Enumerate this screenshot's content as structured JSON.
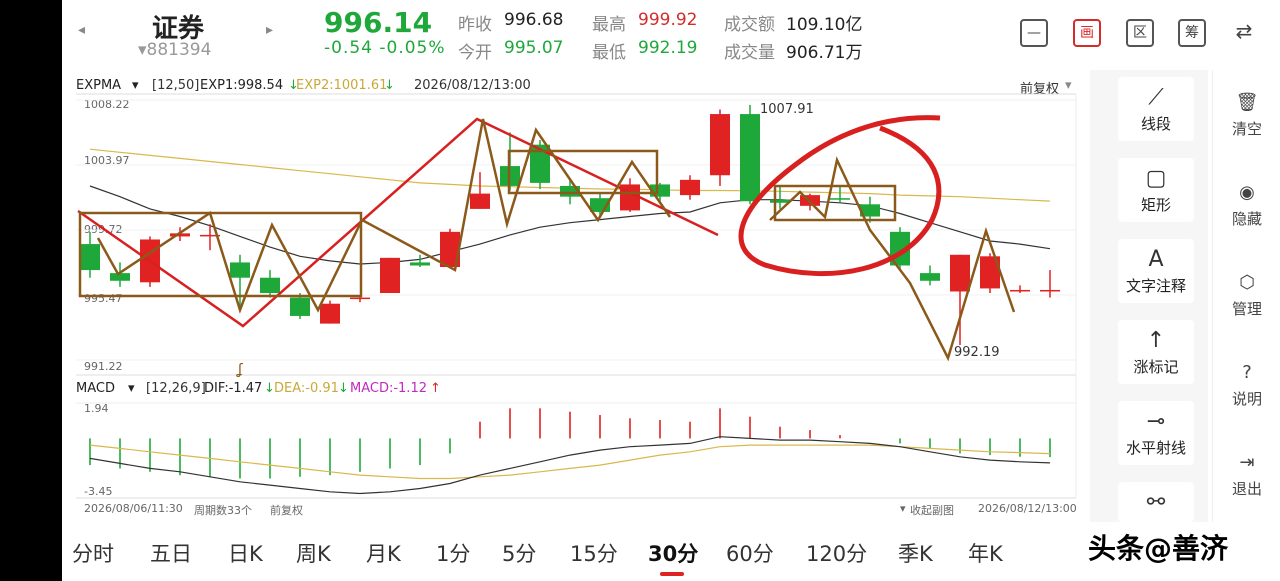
{
  "header": {
    "left_arrow": "◂",
    "right_arrow": "▸",
    "stock_name": "证券",
    "stock_code": "▾881394",
    "price": "996.14",
    "change": "-0.54 -0.05%",
    "quotes": [
      {
        "label": "昨收",
        "value": "996.68"
      },
      {
        "label": "今开",
        "value": "995.07"
      },
      {
        "label": "最高",
        "value": "999.92"
      },
      {
        "label": "最低",
        "value": "992.19"
      },
      {
        "label": "成交额",
        "value": "109.10亿"
      },
      {
        "label": "成交量",
        "value": "906.71万"
      }
    ],
    "tool_buttons": [
      {
        "name": "minus",
        "label": "—"
      },
      {
        "name": "draw",
        "label": "画"
      },
      {
        "name": "zone",
        "label": "区"
      },
      {
        "name": "chip",
        "label": "筹"
      },
      {
        "name": "device",
        "label": "⇄"
      }
    ]
  },
  "chart_data": [
    {
      "type": "candlestick",
      "indicator": "EXPMA",
      "params": "[12,50]",
      "exp1_label": "EXP1:998.54",
      "exp1_arrow": "↓",
      "exp2_label": "EXP2:1001.61",
      "exp2_arrow": "↓",
      "timestamp": "2026/08/12/13:00",
      "adjust": "前复权",
      "y_labels": [
        "1008.22",
        "1003.97",
        "999.72",
        "995.47",
        "991.22"
      ],
      "ylim": [
        991.22,
        1008.22
      ],
      "high_annotation": "1007.91",
      "low_annotation": "992.19",
      "candles": [
        {
          "o": 998.8,
          "h": 999.6,
          "c": 997.1,
          "l": 996.6
        },
        {
          "o": 996.9,
          "h": 997.6,
          "c": 996.4,
          "l": 996.0
        },
        {
          "o": 996.3,
          "h": 999.3,
          "c": 999.1,
          "l": 996.0
        },
        {
          "o": 999.3,
          "h": 999.9,
          "c": 999.5,
          "l": 999.0
        },
        {
          "o": 999.4,
          "h": 1000.1,
          "c": 999.4,
          "l": 998.4
        },
        {
          "o": 997.6,
          "h": 998.1,
          "c": 996.6,
          "l": 994.6
        },
        {
          "o": 996.6,
          "h": 997.1,
          "c": 995.6,
          "l": 995.3
        },
        {
          "o": 995.3,
          "h": 995.6,
          "c": 994.1,
          "l": 993.9
        },
        {
          "o": 993.6,
          "h": 995.1,
          "c": 994.9,
          "l": 993.6
        },
        {
          "o": 995.3,
          "h": 995.4,
          "c": 995.3,
          "l": 995.0
        },
        {
          "o": 995.6,
          "h": 997.9,
          "c": 997.9,
          "l": 995.6
        },
        {
          "o": 997.6,
          "h": 998.1,
          "c": 997.4,
          "l": 997.3
        },
        {
          "o": 997.3,
          "h": 999.8,
          "c": 999.6,
          "l": 997.3
        },
        {
          "o": 1001.1,
          "h": 1003.5,
          "c": 1002.1,
          "l": 1001.1
        },
        {
          "o": 1003.9,
          "h": 1006.1,
          "c": 1002.6,
          "l": 1002.3
        },
        {
          "o": 1005.3,
          "h": 1005.6,
          "c": 1002.8,
          "l": 1002.4
        },
        {
          "o": 1002.6,
          "h": 1003.1,
          "c": 1001.9,
          "l": 1001.4
        },
        {
          "o": 1001.8,
          "h": 1002.1,
          "c": 1000.9,
          "l": 1000.6
        },
        {
          "o": 1001.0,
          "h": 1003.1,
          "c": 1002.7,
          "l": 1000.9
        },
        {
          "o": 1002.7,
          "h": 1002.8,
          "c": 1001.9,
          "l": 1001.6
        },
        {
          "o": 1002.0,
          "h": 1003.3,
          "c": 1003.0,
          "l": 1001.7
        },
        {
          "o": 1003.3,
          "h": 1007.6,
          "c": 1007.3,
          "l": 1002.6
        },
        {
          "o": 1007.3,
          "h": 1007.9,
          "c": 1001.6,
          "l": 1001.4
        },
        {
          "o": 1001.7,
          "h": 1002.6,
          "c": 1001.5,
          "l": 1001.1
        },
        {
          "o": 1001.3,
          "h": 1002.1,
          "c": 1002.0,
          "l": 1001.0
        },
        {
          "o": 1001.8,
          "h": 1002.6,
          "c": 1001.7,
          "l": 1001.5
        },
        {
          "o": 1001.4,
          "h": 1001.9,
          "c": 1000.6,
          "l": 1000.2
        },
        {
          "o": 999.6,
          "h": 999.9,
          "c": 997.4,
          "l": 997.2
        },
        {
          "o": 996.9,
          "h": 997.4,
          "c": 996.4,
          "l": 996.1
        },
        {
          "o": 995.7,
          "h": 998.1,
          "c": 998.1,
          "l": 992.2
        },
        {
          "o": 995.9,
          "h": 998.2,
          "c": 998.0,
          "l": 995.6
        },
        {
          "o": 995.7,
          "h": 996.1,
          "c": 995.8,
          "l": 995.6
        },
        {
          "o": 995.7,
          "h": 997.1,
          "c": 995.8,
          "l": 995.3
        }
      ],
      "exp1": [
        1002.6,
        1001.9,
        1001.1,
        1000.6,
        1000.0,
        999.3,
        998.6,
        998.0,
        997.7,
        997.5,
        997.6,
        997.8,
        998.3,
        998.8,
        999.4,
        999.9,
        1000.2,
        1000.4,
        1000.6,
        1000.8,
        1000.9,
        1001.5,
        1001.7,
        1001.7,
        1001.6,
        1001.5,
        1001.3,
        1000.8,
        1000.2,
        999.6,
        999.0,
        998.8,
        998.5
      ],
      "exp2": [
        1005.0,
        1004.8,
        1004.6,
        1004.4,
        1004.2,
        1004.0,
        1003.8,
        1003.6,
        1003.4,
        1003.2,
        1003.0,
        1002.8,
        1002.7,
        1002.6,
        1002.55,
        1002.5,
        1002.45,
        1002.4,
        1002.38,
        1002.35,
        1002.3,
        1002.3,
        1002.28,
        1002.25,
        1002.2,
        1002.15,
        1002.1,
        1002.0,
        1001.95,
        1001.9,
        1001.8,
        1001.7,
        1001.61
      ]
    },
    {
      "type": "bar",
      "indicator": "MACD",
      "params": "[12,26,9]",
      "dif_label": "DIF:-1.47",
      "dif_arrow": "↓",
      "dea_label": "DEA:-0.91",
      "dea_arrow": "↓",
      "macd_label": "MACD:-1.12",
      "macd_arrow": "↑",
      "y_labels": [
        "1.94",
        "-3.45"
      ],
      "ylim": [
        -3.45,
        1.94
      ],
      "macd": [
        -1.6,
        -1.8,
        -2.0,
        -2.2,
        -2.3,
        -2.4,
        -2.4,
        -2.3,
        -2.2,
        -2.0,
        -1.8,
        -1.6,
        -0.9,
        1.0,
        1.8,
        1.8,
        1.6,
        1.4,
        1.2,
        1.1,
        1.0,
        1.8,
        1.3,
        0.7,
        0.5,
        0.2,
        0.0,
        -0.3,
        -0.6,
        -0.9,
        -1.0,
        -1.1,
        -1.12
      ],
      "dif": [
        -1.2,
        -1.5,
        -1.8,
        -2.0,
        -2.3,
        -2.6,
        -2.8,
        -3.0,
        -3.2,
        -3.3,
        -3.2,
        -3.0,
        -2.7,
        -2.2,
        -1.8,
        -1.4,
        -1.0,
        -0.7,
        -0.5,
        -0.4,
        -0.3,
        0.1,
        0.0,
        -0.1,
        -0.1,
        -0.2,
        -0.3,
        -0.5,
        -0.8,
        -1.1,
        -1.3,
        -1.4,
        -1.47
      ],
      "dea": [
        -0.4,
        -0.6,
        -0.8,
        -1.0,
        -1.2,
        -1.4,
        -1.6,
        -1.8,
        -2.0,
        -2.2,
        -2.3,
        -2.4,
        -2.4,
        -2.3,
        -2.2,
        -2.0,
        -1.8,
        -1.6,
        -1.3,
        -1.0,
        -0.8,
        -0.5,
        -0.4,
        -0.4,
        -0.4,
        -0.4,
        -0.4,
        -0.5,
        -0.6,
        -0.7,
        -0.8,
        -0.85,
        -0.91
      ]
    }
  ],
  "chart_footer": {
    "start_time": "2026/08/06/11:30",
    "period_count": "周期数33个",
    "adjust": "前复权",
    "collapse": "收起副图",
    "end_time": "2026/08/12/13:00"
  },
  "draw_tools": [
    {
      "icon": "line-segment",
      "glyph": "⟋",
      "label": "线段"
    },
    {
      "icon": "rectangle",
      "glyph": "▢",
      "label": "矩形"
    },
    {
      "icon": "text",
      "glyph": "A",
      "label": "文字注释"
    },
    {
      "icon": "arrow-up",
      "glyph": "↑",
      "label": "涨标记"
    },
    {
      "icon": "ray",
      "glyph": "⊸",
      "label": "水平射线"
    },
    {
      "icon": "more",
      "glyph": "⚯",
      "label": ""
    }
  ],
  "collapse_arrow": "‹",
  "side_actions": [
    {
      "icon": "clear",
      "glyph": "🗑",
      "label": "清空"
    },
    {
      "icon": "eye",
      "glyph": "◉",
      "label": "隐藏"
    },
    {
      "icon": "settings",
      "glyph": "⬡",
      "label": "管理"
    },
    {
      "icon": "help",
      "glyph": "?",
      "label": "说明"
    },
    {
      "icon": "exit",
      "glyph": "⇥",
      "label": "退出"
    }
  ],
  "periods": [
    "分时",
    "五日",
    "日K",
    "周K",
    "月K",
    "1分",
    "5分",
    "15分",
    "30分",
    "60分",
    "120分",
    "季K",
    "年K"
  ],
  "active_period": "30分",
  "watermark": "头条@善济",
  "colors": {
    "up": "#e02222",
    "down": "#1fa83a",
    "exp1": "#333333",
    "exp2": "#d9b84a",
    "annotation_red": "#d92020",
    "annotation_brown": "#8b5a1b"
  }
}
